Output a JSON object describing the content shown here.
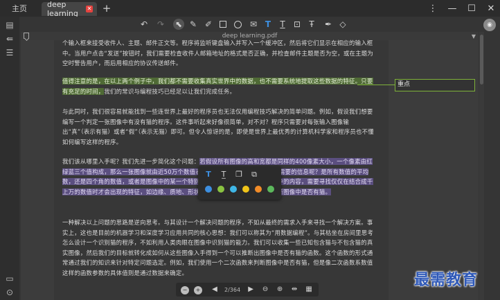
{
  "titlebar": {
    "home_tab": "主页",
    "doc_tab": "deep learning",
    "close_glyph": "✕",
    "add_glyph": "+",
    "window_controls": [
      "⋮",
      "—",
      "☐",
      "✕"
    ]
  },
  "toolbar": {
    "tools": [
      "undo-icon",
      "redo-icon",
      "select-icon",
      "pen-icon",
      "highlighter-icon",
      "rectangle-icon",
      "ellipse-icon",
      "note-icon",
      "text-highlight-icon",
      "text-underline-icon",
      "text-box-icon",
      "strikethrough-icon",
      "marker-icon",
      "eraser-icon"
    ],
    "avatar_glyph": "◉"
  },
  "document": {
    "title": "deep learning.pdf",
    "para1": "个输入框来接受收件人、主题、邮件正文等。程序将监听键盘输入并写入一个缓冲区，然后将它们显示在相应的输入框中。当用户点击“发送”按钮时，我们需要检查收件人邮箱地址的格式是否正确，并检查邮件主题是否为空，或在主题为空时警告用户，而后用相应的协议传送邮件。",
    "para2_highlight": "值得注意的是，在以上两个例子中，我们都不需要收集真实世界中的数据，也不需要系统地提取这些数据的特征。只要有充足的时间，",
    "para2_rest": "我们的常识与编程技巧已经足以让我们完成任务。",
    "para3": "与此同时，我们很容易就能找到一些连世界上最好的程序员也无法仅用编程技巧解决的简单问题。例如，假设我们想要编写一个判定一张图像中有没有猫的程序。这件事听起来好像很简单，对不对？程序只需要对每张输入图像输出“真”（表示有猫）或者“假”（表示无猫）即可。但令人惊讶的是，即使是世界上最优秀的计算机科学家和程序员也不懂如何编写这样的程序。",
    "para4_plain": "我们该从哪里入手呢？我们先进一步简化这个问题：",
    "para4_highlight": "若假设所有图像的高和宽都是同样的400像素大小，一个像素由红绿蓝三个值构成，那么一张图像就由近50万个数值表示。那么哪些数值隐藏着我们需要的信息呢？是所有数值的平均数，还是四个角的数值，或者是图像中的某一个特别的点？事实上，要想解读图像中的内容，需要寻找仅仅在结合成千上万的数值时才会出现的特征，如边缘、质地、形状、眼睛、鼻子等，最终才能判断图像中是否有猫。",
    "para5": "一种解决以上问题的思路是逆向思考。与其设计一个解决问题的程序，不如从最终的需求入手来寻找一个解决方案。事实上，这也是目前的机器学习和深度学习应用共同的核心思想：我们可以称其为“用数据编程”。与其枯坐在房间里思考怎么设计一个识别猫的程序，不如利用人类肉眼在图像中识别猫的能力。我们可以收集一些已知包含猫与不包含猫的真实图像，然后我们的目标就转化成如何从这些图像入手得到一个可以推断出图像中是否有猫的函数。这个函数的形式通常通过我们的知识来针对特定问题选定。例如，我们使用一个二次函数来判断图像中是否有猫，但是像二次函数系数值这样的函数参数的具体值则是通过数据来确定。"
  },
  "note": {
    "label": "重点"
  },
  "popup": {
    "tools": [
      "T",
      "T̲",
      "❐",
      "⧉"
    ],
    "colors": [
      "#3d8fe0",
      "#8ac341",
      "#3fb6e6",
      "#f0c419",
      "#f28c28",
      "#5cb85c"
    ]
  },
  "pagenav": {
    "zoom_out_glyph": "−",
    "zoom_in_glyph": "+",
    "prev_glyph": "◀",
    "page_indicator": "2/364",
    "next_glyph": "▶",
    "fit_glyph": "⊖",
    "fit2_glyph": "⊕",
    "width_glyph": "⇹",
    "page_glyph": "▦"
  },
  "watermark": {
    "text": "最需教育"
  }
}
